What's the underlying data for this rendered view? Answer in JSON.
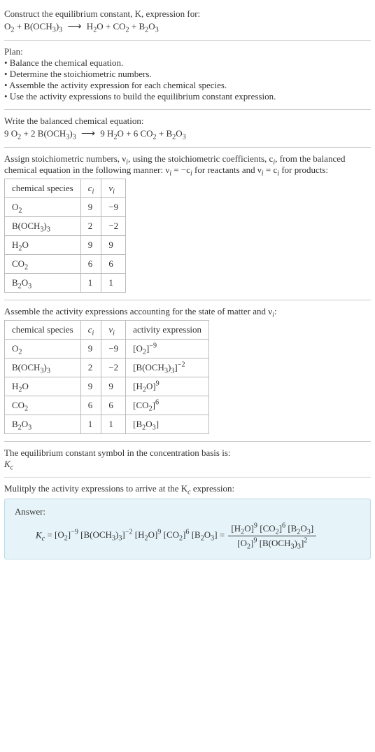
{
  "s1": {
    "line1": "Construct the equilibrium constant, K, expression for:",
    "eq_lhs1": "O",
    "eq_lhs1s": "2",
    "eq_plus": " + ",
    "eq_lhs2": "B(OCH",
    "eq_lhs2s": "3",
    "eq_lhs2b": ")",
    "eq_lhs2bs": "3",
    "arrow": "⟶",
    "eq_rhs1": "H",
    "eq_rhs1s": "2",
    "eq_rhs1b": "O",
    "eq_rhs2": "CO",
    "eq_rhs2s": "2",
    "eq_rhs3": "B",
    "eq_rhs3s": "2",
    "eq_rhs3b": "O",
    "eq_rhs3bs": "3"
  },
  "s2": {
    "title": "Plan:",
    "b1": "• Balance the chemical equation.",
    "b2": "• Determine the stoichiometric numbers.",
    "b3": "• Assemble the activity expression for each chemical species.",
    "b4": "• Use the activity expressions to build the equilibrium constant expression."
  },
  "s3": {
    "title": "Write the balanced chemical equation:",
    "c1": "9 ",
    "c2": "2 ",
    "c3": "9 ",
    "c4": "6 "
  },
  "s4": {
    "p1a": "Assign stoichiometric numbers, ν",
    "p1a_sub": "i",
    "p1b": ", using the stoichiometric coefficients, c",
    "p1b_sub": "i",
    "p1c": ", from the balanced chemical equation in the following manner: ν",
    "p1c_sub": "i",
    "p1d": " = −c",
    "p1d_sub": "i",
    "p1e": " for reactants and ν",
    "p1e_sub": "i",
    "p1f": " = c",
    "p1f_sub": "i",
    "p1g": " for products:",
    "h1": "chemical species",
    "h2": "c",
    "h2s": "i",
    "h3": "ν",
    "h3s": "i",
    "r1c1": "O",
    "r1c1s": "2",
    "r1c2": "9",
    "r1c3": "−9",
    "r2c1": "B(OCH",
    "r2c1s": "3",
    "r2c1b": ")",
    "r2c1bs": "3",
    "r2c2": "2",
    "r2c3": "−2",
    "r3c1": "H",
    "r3c1s": "2",
    "r3c1b": "O",
    "r3c2": "9",
    "r3c3": "9",
    "r4c1": "CO",
    "r4c1s": "2",
    "r4c2": "6",
    "r4c3": "6",
    "r5c1": "B",
    "r5c1s": "2",
    "r5c1b": "O",
    "r5c1bs": "3",
    "r5c2": "1",
    "r5c3": "1"
  },
  "s5": {
    "title_a": "Assemble the activity expressions accounting for the state of matter and ν",
    "title_sub": "i",
    "title_b": ":",
    "h4": "activity expression",
    "r1a": "[O",
    "r1as": "2",
    "r1ab": "]",
    "r1ax": "−9",
    "r2a": "[B(OCH",
    "r2as": "3",
    "r2ab": ")",
    "r2abs": "3",
    "r2ac": "]",
    "r2ax": "−2",
    "r3a": "[H",
    "r3as": "2",
    "r3ab": "O]",
    "r3ax": "9",
    "r4a": "[CO",
    "r4as": "2",
    "r4ab": "]",
    "r4ax": "6",
    "r5a": "[B",
    "r5as": "2",
    "r5ab": "O",
    "r5abs": "3",
    "r5ac": "]"
  },
  "s6": {
    "l1": "The equilibrium constant symbol in the concentration basis is:",
    "sym": "K",
    "syms": "c"
  },
  "s7": {
    "title": "Mulitply the activity expressions to arrive at the K",
    "title_s": "c",
    "title_b": " expression:",
    "ans": "Answer:",
    "eq": " = ",
    "num_h2o_x": "9",
    "num_co2_x": "6",
    "den_o2_x": "9",
    "den_boch_x": "2"
  },
  "chart_data": {
    "type": "table",
    "title": "Stoichiometric numbers and activity expressions",
    "columns": [
      "chemical species",
      "c_i",
      "ν_i",
      "activity expression"
    ],
    "rows": [
      {
        "species": "O2",
        "c_i": 9,
        "nu_i": -9,
        "activity": "[O2]^-9"
      },
      {
        "species": "B(OCH3)3",
        "c_i": 2,
        "nu_i": -2,
        "activity": "[B(OCH3)3]^-2"
      },
      {
        "species": "H2O",
        "c_i": 9,
        "nu_i": 9,
        "activity": "[H2O]^9"
      },
      {
        "species": "CO2",
        "c_i": 6,
        "nu_i": 6,
        "activity": "[CO2]^6"
      },
      {
        "species": "B2O3",
        "c_i": 1,
        "nu_i": 1,
        "activity": "[B2O3]"
      }
    ],
    "balanced_equation": "9 O2 + 2 B(OCH3)3 ⟶ 9 H2O + 6 CO2 + B2O3",
    "Kc_expression": "Kc = [O2]^-9 [B(OCH3)3]^-2 [H2O]^9 [CO2]^6 [B2O3] = ([H2O]^9 [CO2]^6 [B2O3]) / ([O2]^9 [B(OCH3)3]^2)"
  }
}
